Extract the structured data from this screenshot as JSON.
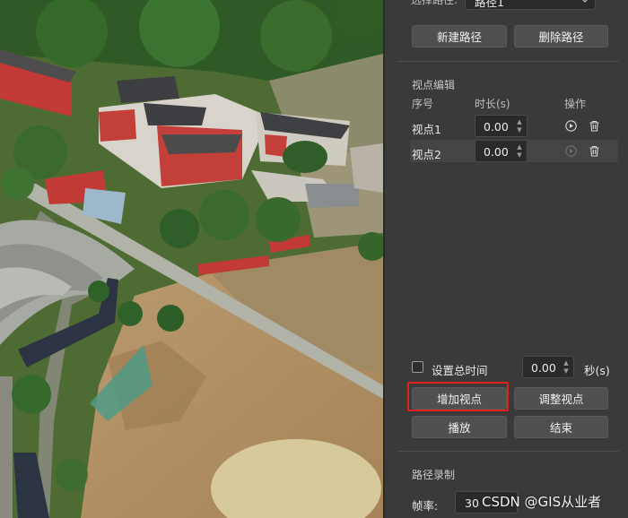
{
  "route": {
    "select_label": "选择路径:",
    "selected_value": "路径1",
    "new_button": "新建路径",
    "delete_button": "删除路径"
  },
  "viewpoint_editor": {
    "title": "视点编辑",
    "columns": [
      "序号",
      "时长(s)",
      "操作"
    ],
    "rows": [
      {
        "name": "视点1",
        "duration": "0.00"
      },
      {
        "name": "视点2",
        "duration": "0.00"
      }
    ]
  },
  "controls": {
    "total_time_label": "设置总时间",
    "total_time_checked": false,
    "total_time_value": "0.00",
    "total_time_unit": "秒(s)",
    "add_viewpoint_button": "增加视点",
    "adjust_viewpoint_button": "调整视点",
    "play_button": "播放",
    "end_button": "结束"
  },
  "recording": {
    "title": "路径录制",
    "fps_label": "帧率:",
    "fps_value": "30"
  },
  "watermark": "CSDN @GIS从业者",
  "colors": {
    "panel_bg": "#3a3a3a",
    "button_bg": "#505050",
    "highlight": "#e0201c"
  }
}
